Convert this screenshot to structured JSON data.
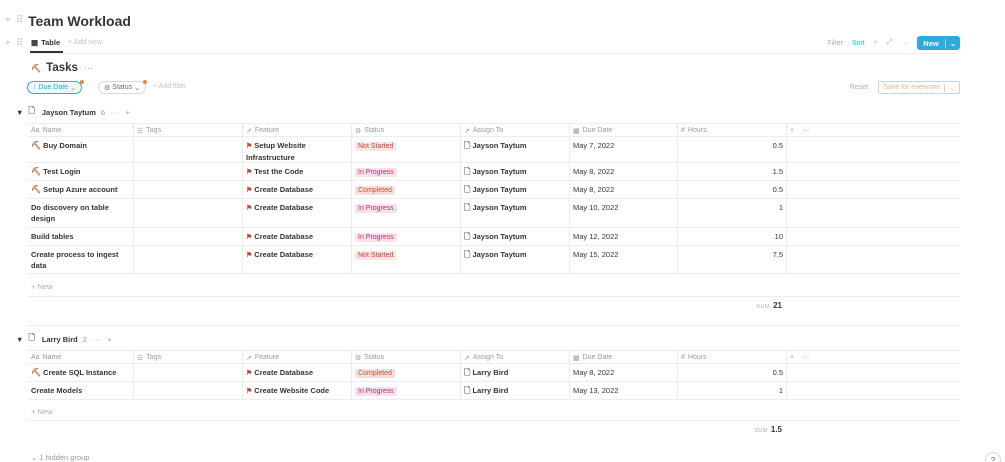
{
  "page": {
    "title": "Team Workload"
  },
  "view": {
    "tab_label": "Table",
    "add_view": "Add view",
    "filter": "Filter",
    "sort": "Sort",
    "new_label": "New"
  },
  "database": {
    "title": "Tasks"
  },
  "filters": {
    "due_date": "Due Date",
    "status": "Status",
    "add_filter": "Add filter",
    "reset": "Reset",
    "save": "Save for everyone"
  },
  "columns": [
    "Name",
    "Tags",
    "Feature",
    "Status",
    "Assign To",
    "Due Date",
    "Hours"
  ],
  "groups": [
    {
      "name": "Jayson Taytum",
      "count": "6",
      "rows": [
        {
          "name": "Buy Domain",
          "icon": true,
          "feature": "Setup Website Infrastructure",
          "status": "Not Started",
          "assign": "Jayson Taytum",
          "due": "May 7, 2022",
          "hours": "0.5"
        },
        {
          "name": "Test Login",
          "icon": true,
          "feature": "Test the Code",
          "status": "In Progress",
          "assign": "Jayson Taytum",
          "due": "May 8, 2022",
          "hours": "1.5"
        },
        {
          "name": "Setup Azure account",
          "icon": true,
          "feature": "Create Database",
          "status": "Completed",
          "assign": "Jayson Taytum",
          "due": "May 8, 2022",
          "hours": "0.5"
        },
        {
          "name": "Do discovery on table design",
          "icon": false,
          "feature": "Create Database",
          "status": "In Progress",
          "assign": "Jayson Taytum",
          "due": "May 10, 2022",
          "hours": "1"
        },
        {
          "name": "Build tables",
          "icon": false,
          "feature": "Create Database",
          "status": "In Progress",
          "assign": "Jayson Taytum",
          "due": "May 12, 2022",
          "hours": "10"
        },
        {
          "name": "Create process to ingest data",
          "icon": false,
          "feature": "Create Database",
          "status": "Not Started",
          "assign": "Jayson Taytum",
          "due": "May 15, 2022",
          "hours": "7.5"
        }
      ],
      "new_label": "New",
      "sum_label": "SUM",
      "sum": "21"
    },
    {
      "name": "Larry Bird",
      "count": "2",
      "rows": [
        {
          "name": "Create SQL Instance",
          "icon": true,
          "feature": "Create Database",
          "status": "Completed",
          "assign": "Larry Bird",
          "due": "May 8, 2022",
          "hours": "0.5"
        },
        {
          "name": "Create Models",
          "icon": false,
          "feature": "Create Website Code",
          "status": "In Progress",
          "assign": "Larry Bird",
          "due": "May 13, 2022",
          "hours": "1"
        }
      ],
      "new_label": "New",
      "sum_label": "SUM",
      "sum": "1.5"
    }
  ],
  "hidden_group": "1 hidden group",
  "help": "?",
  "colors": {
    "accent": "#2eaadc",
    "not_started": "#c9433a",
    "in_progress": "#b5366b",
    "completed": "#b9573f"
  }
}
